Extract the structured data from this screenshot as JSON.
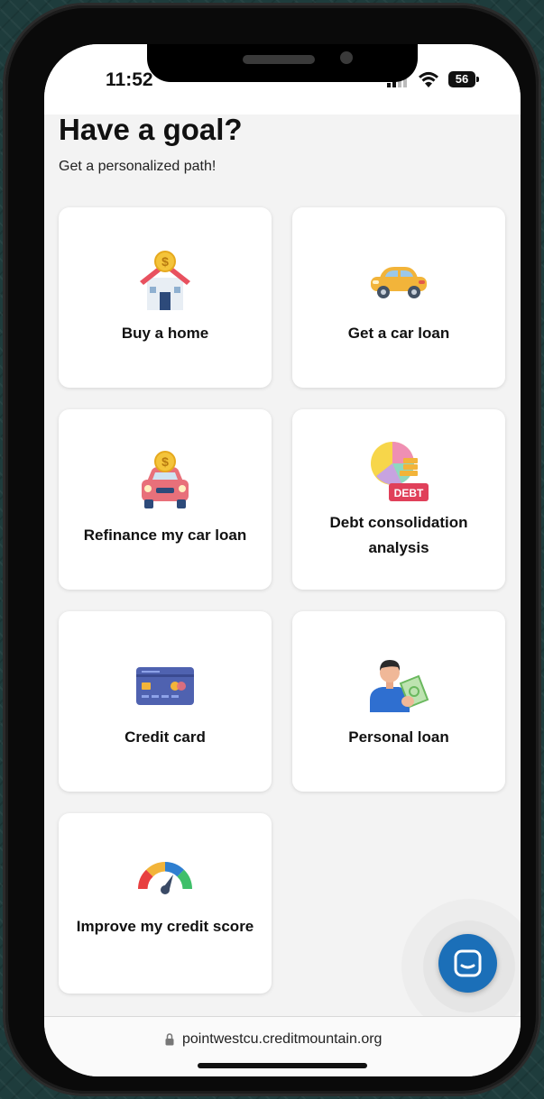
{
  "status_bar": {
    "time": "11:52",
    "battery": "56"
  },
  "page": {
    "title": "Have a goal?",
    "subtitle": "Get a personalized path!"
  },
  "goals": [
    {
      "label": "Buy a home",
      "icon": "house-coin-icon"
    },
    {
      "label": "Get a car loan",
      "icon": "car-icon"
    },
    {
      "label": "Refinance my car loan",
      "icon": "car-coin-icon"
    },
    {
      "label": "Debt consolidation analysis",
      "icon": "debt-chart-icon"
    },
    {
      "label": "Credit card",
      "icon": "credit-card-icon"
    },
    {
      "label": "Personal loan",
      "icon": "person-money-icon"
    },
    {
      "label": "Improve my credit score",
      "icon": "credit-gauge-icon"
    }
  ],
  "chat": {
    "icon": "chat-icon"
  },
  "browser": {
    "url": "pointwestcu.creditmountain.org"
  },
  "colors": {
    "chat_button": "#1b6fb8",
    "card_background": "#ffffff",
    "page_background": "#f3f3f3"
  }
}
